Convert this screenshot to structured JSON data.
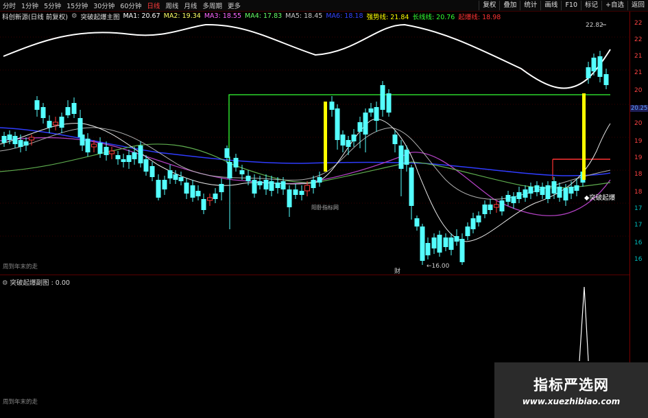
{
  "toolbar": {
    "timeframes": [
      "分时",
      "1分钟",
      "5分钟",
      "15分钟",
      "30分钟",
      "60分钟",
      "日线",
      "周线",
      "月线",
      "多周期",
      "更多"
    ],
    "active_timeframe": "日线",
    "right_buttons": [
      "复权",
      "叠加",
      "统计",
      "画线",
      "F10",
      "标记",
      "+自选",
      "返回"
    ]
  },
  "infobar": {
    "stock": "科创新源(日线 前复权)",
    "indicator": "突破起爆主图",
    "items": [
      {
        "label": "MA1: 20.67",
        "color": "#ffffff"
      },
      {
        "label": "MA2: 19.34",
        "color": "#ffff66"
      },
      {
        "label": "MA3: 18.55",
        "color": "#ff66ff"
      },
      {
        "label": "MA4: 17.83",
        "color": "#66ff66"
      },
      {
        "label": "MA5: 18.45",
        "color": "#c8c8c8"
      },
      {
        "label": "MA6: 18.18",
        "color": "#3344ff"
      },
      {
        "label": "强势线: 21.84",
        "color": "#ffff00"
      },
      {
        "label": "长线线: 20.76",
        "color": "#33ff33"
      },
      {
        "label": "起爆线: 18.98",
        "color": "#ff3333"
      }
    ]
  },
  "price_axis": {
    "ticks": [
      "22",
      "22",
      "21",
      "21",
      "20",
      "20",
      "19",
      "19",
      "18",
      "18",
      "17",
      "17",
      "16",
      "16"
    ],
    "current_price": "20.25"
  },
  "annotations": {
    "peak_label": "22.82",
    "low_label": "←16.00",
    "breakout_label": "◆突破起爆",
    "bottom_note": "阳卧指标网",
    "upper_left_note": "周到年末的走",
    "event_marker": "财"
  },
  "sub_indicator": {
    "title": "突破起爆副图 : 0.00",
    "left_note": "周到年末的走"
  },
  "watermark": {
    "cn": "指标严选网",
    "en": "www.xuezhibiao.com"
  },
  "colors": {
    "up_candle": "#ff3b3b",
    "down_candle": "#54ffff",
    "strong_line": "#ffff00",
    "long_line": "#33ff33",
    "burst_line": "#ff3333",
    "background": "#000000"
  }
}
